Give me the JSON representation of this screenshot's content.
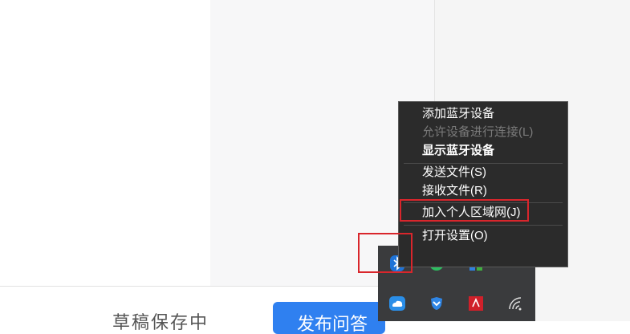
{
  "background": {
    "draft_label": "草稿保存中",
    "publish_label": "发布问答"
  },
  "context_menu": {
    "items": [
      {
        "label": "添加蓝牙设备",
        "state": "normal"
      },
      {
        "label": "允许设备进行连接(L)",
        "state": "disabled"
      },
      {
        "label": "显示蓝牙设备",
        "state": "bold"
      },
      {
        "label": "发送文件(S)",
        "state": "normal"
      },
      {
        "label": "接收文件(R)",
        "state": "normal"
      },
      {
        "label": "加入个人区域网(J)",
        "state": "highlighted"
      },
      {
        "label": "打开设置(O)",
        "state": "normal"
      }
    ]
  },
  "tray": {
    "icons": [
      "bluetooth-icon",
      "evernote-icon",
      "color-squares-icon",
      "cloud-icon",
      "shield-icon",
      "amd-icon",
      "wifi-icon"
    ]
  },
  "colors": {
    "highlight": "#d9262c",
    "menu_bg": "#2b2b2b",
    "tray_bg": "#3a3b3d",
    "publish_button": "#2f80f0"
  }
}
